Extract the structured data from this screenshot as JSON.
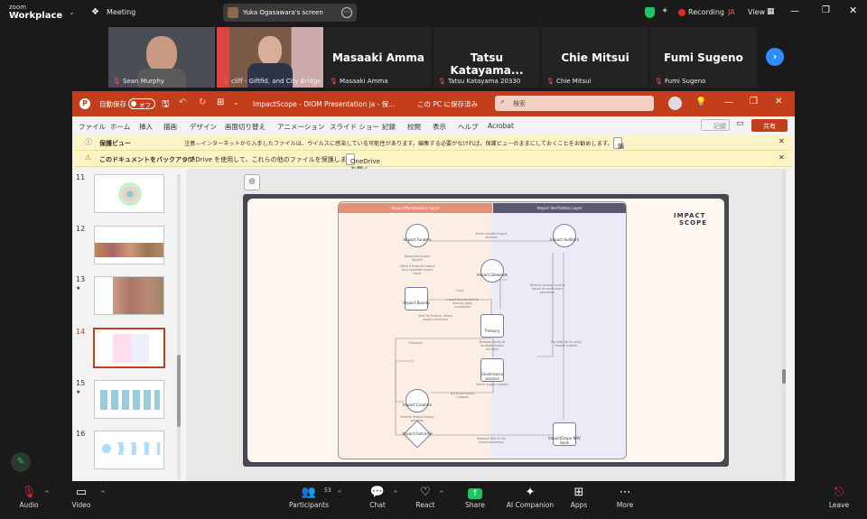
{
  "zoom": {
    "brand_top": "zoom",
    "brand_bottom": "Workplace",
    "meeting_label": "Meeting",
    "screen_share_label": "Yuka Ogasawara's screen",
    "recording_label": "Recording",
    "recording_badge": "JA",
    "view_label": "View"
  },
  "participants": [
    {
      "name": "Sean Murphy",
      "video": true
    },
    {
      "name": "cliff - Giftfid, and City Bridge ...",
      "video": true
    },
    {
      "name": "Masaaki Amma",
      "display": "Masaaki Amma"
    },
    {
      "name": "Tatsu Katayama 20330",
      "display": "Tatsu Katayama..."
    },
    {
      "name": "Chie Mitsui",
      "display": "Chie Mitsui"
    },
    {
      "name": "Fumi Sugeno",
      "display": "Fumi Sugeno"
    }
  ],
  "ppt": {
    "autosave_label": "自動保存",
    "autosave_state": "オフ",
    "doc_title": "ImpactScope - DIOM Presentation ja - 保...",
    "save_status": "この PC に保存済み",
    "search_placeholder": "検索",
    "menu": [
      "ファイル",
      "ホーム",
      "挿入",
      "描画",
      "デザイン",
      "画面切り替え",
      "アニメーション",
      "スライド ショー",
      "記録",
      "校閲",
      "表示",
      "ヘルプ",
      "Acrobat"
    ],
    "record_label": "記録",
    "share_label": "共有",
    "protected_view_title": "保護ビュー",
    "protected_view_msg": "注意—インターネットから入手したファイルは、ウイルスに感染している可能性があります。編集する必要がなければ、保護ビューのままにしておくことをお勧めします。",
    "enable_editing": "編集を有効にする(E)",
    "backup_title": "このドキュメントをバックアップ",
    "backup_msg": "OneDrive を使用して、これらの他のファイルを保護します。",
    "open_onedrive": "OneDrive を開く",
    "thumbnails": [
      {
        "num": "11",
        "star": false
      },
      {
        "num": "12",
        "star": false
      },
      {
        "num": "13",
        "star": true
      },
      {
        "num": "14",
        "star": false,
        "selected": true
      },
      {
        "num": "15",
        "star": true
      },
      {
        "num": "16",
        "star": false
      }
    ]
  },
  "slide": {
    "logo_top": "IMPACT",
    "logo_bottom": "SCOPE",
    "layer_left": "Impact Monetization Layer",
    "layer_right": "Impact Verification Layer",
    "nodes": {
      "funders": "Impact Funders",
      "auditors": "Impact Auditors",
      "stewards": "Impact Stewards",
      "bounty": "Impact Bounty",
      "treasury": "Treasury",
      "governance": "Governance process",
      "creators": "Impact Creators",
      "outcome": "Impact Outcome",
      "nav": "ImpactScope NAV tools"
    },
    "edges": {
      "select_auditors": "Select desired Impact Auditors",
      "deposit": "Deposit to Impact Bounty",
      "offer": "Offers a financial reward for a specified impact result",
      "sell_to": "Sell to Impact Funders",
      "fund": "Fund",
      "impact_bounty_sent": "Impact Bounty sent to treasury upon completion",
      "financing": "Financing",
      "seek": "Seek for finance, Select Impact outcomes",
      "releases": "Releases funds to facilitate impact activities",
      "select_impact": "Select impact creators",
      "notes": "Votes to release funding based on verification procedure",
      "pay_fees": "Pay NAV fee to verify impact creation",
      "bid": "Bid to be Impact Creators",
      "perform": "Perform desired impact activities",
      "measure": "Measure NAV of the impact outcomes"
    }
  },
  "toolbar": {
    "audio": "Audio",
    "video": "Video",
    "participants": "Participants",
    "participants_count": "53",
    "chat": "Chat",
    "react": "React",
    "share": "Share",
    "ai_companion": "AI Companion",
    "apps": "Apps",
    "more": "More",
    "leave": "Leave"
  },
  "colors": {
    "ppt_red": "#c43e1c",
    "zoom_bg": "#1a1a1a",
    "share_green": "#1ec463",
    "leave_red": "#e02828",
    "thumb_select": "#c43e1c"
  }
}
